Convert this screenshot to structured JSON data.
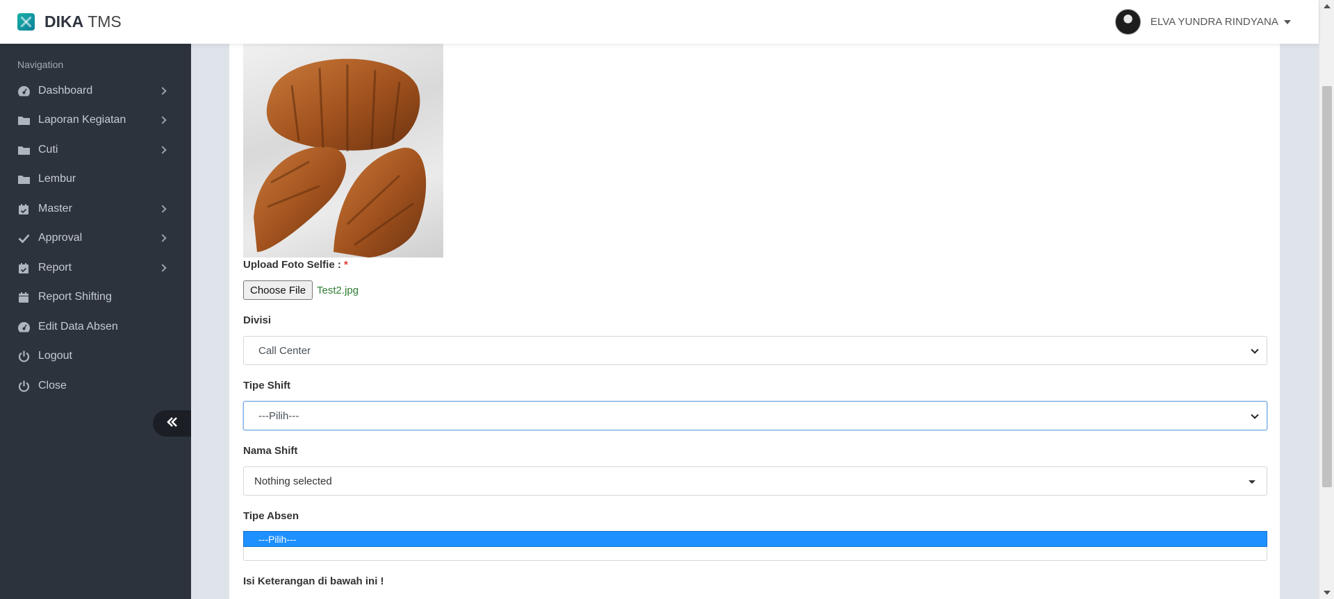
{
  "brand": {
    "name_bold": "DIKA",
    "name_light": "TMS",
    "logo_color": "#17b0a7"
  },
  "user": {
    "name": "ELVA YUNDRA RINDYANA"
  },
  "sidebar": {
    "heading": "Navigation",
    "items": [
      {
        "label": "Dashboard",
        "icon": "dashboard-icon",
        "has_submenu": true
      },
      {
        "label": "Laporan Kegiatan",
        "icon": "folder-icon",
        "has_submenu": true
      },
      {
        "label": "Cuti",
        "icon": "folder-icon",
        "has_submenu": true
      },
      {
        "label": "Lembur",
        "icon": "folder-icon",
        "has_submenu": false
      },
      {
        "label": "Master",
        "icon": "calendar-check-icon",
        "has_submenu": true
      },
      {
        "label": "Approval",
        "icon": "check-icon",
        "has_submenu": true
      },
      {
        "label": "Report",
        "icon": "calendar-check-icon",
        "has_submenu": true
      },
      {
        "label": "Report Shifting",
        "icon": "calendar-icon",
        "has_submenu": false
      },
      {
        "label": "Edit Data Absen",
        "icon": "dashboard-icon",
        "has_submenu": false
      },
      {
        "label": "Logout",
        "icon": "power-icon",
        "has_submenu": false
      },
      {
        "label": "Close",
        "icon": "power-icon",
        "has_submenu": false
      }
    ],
    "collapse_icon": "double-chevron-left-icon",
    "bg_color": "#2d333d"
  },
  "form": {
    "upload_label": "Upload Foto Selfie :",
    "required_mark": "*",
    "file_button": "Choose File",
    "file_name": "Test2.jpg",
    "divisi_label": "Divisi",
    "divisi_value": "Call Center",
    "tipe_shift_label": "Tipe Shift",
    "tipe_shift_value": "---Pilih---",
    "nama_shift_label": "Nama Shift",
    "nama_shift_value": "Nothing selected",
    "tipe_absen_label": "Tipe Absen",
    "tipe_absen_option": "---Pilih---",
    "keterangan_label": "Isi Keterangan di bawah ini !"
  },
  "colors": {
    "highlight": "#1e90ff",
    "file_name": "#2e7d32",
    "required": "#e53935"
  }
}
